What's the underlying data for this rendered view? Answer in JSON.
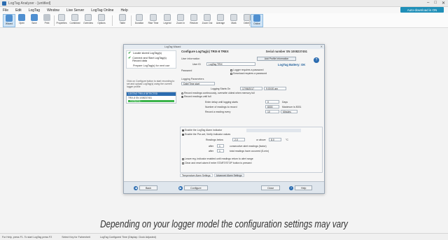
{
  "window": {
    "title": "LogTag Analyzer - [untitled]",
    "controls": [
      "–",
      "□",
      "✕"
    ]
  },
  "menu": [
    "File",
    "Edit",
    "LogTag",
    "Window",
    "Live Server",
    "LogTag Online",
    "Help"
  ],
  "auto_download": "Auto-download is ON",
  "toolbar": [
    {
      "label": "Wizard",
      "icon": "wizard-icon",
      "active": true
    },
    {
      "label": "Open",
      "icon": "open-icon"
    },
    {
      "label": "Save",
      "icon": "save-icon"
    },
    {
      "label": "Print",
      "icon": "print-icon"
    },
    {
      "label": "Properties",
      "icon": "properties-icon"
    },
    {
      "label": "Combined",
      "icon": "combined-icon"
    },
    {
      "label": "Overview",
      "icon": "overview-icon"
    },
    {
      "label": "Options",
      "icon": "options-icon"
    },
    {
      "label": "Table",
      "icon": "table-icon"
    },
    {
      "label": "Duration",
      "icon": "duration-icon"
    },
    {
      "label": "Rise Time",
      "icon": "rise-time-icon"
    },
    {
      "label": "Legend",
      "icon": "legend-icon"
    },
    {
      "label": "Zoom In",
      "icon": "zoom-in-icon"
    },
    {
      "label": "Restore",
      "icon": "restore-icon"
    },
    {
      "label": "Zoom Out",
      "icon": "zoom-out-icon"
    },
    {
      "label": "Average",
      "icon": "average-icon"
    },
    {
      "label": "Mark",
      "icon": "mark-icon"
    },
    {
      "label": "Delete",
      "icon": "delete-icon"
    },
    {
      "label": "Online",
      "icon": "online-icon"
    }
  ],
  "dialog": {
    "title": "LogTag Wizard",
    "steps": [
      {
        "label": "Locate stored LogTag(s)",
        "done": true
      },
      {
        "label": "Connect and Start LogTag(s) Record data",
        "done": true
      },
      {
        "label": "Prepare LogTag(s) for next use",
        "done": false
      }
    ],
    "help_text": "Click on Configure button to start recording to set and upload LogTag(s) using the current logger profile",
    "logger_box": {
      "header": "LOGTAG TRIX-8 DETECTED",
      "id": "TRIX-8 SN 1008237451",
      "status": "Configuring..."
    },
    "heading": "Configure LogTag(s) TRIX-8 TREX",
    "serial": "Serial number SN 1008237451",
    "user_info_label": "User information",
    "user_id_label": "User ID",
    "user_id_value": "LogTag TRIX",
    "battery": "LogTag Battery: OK",
    "password_label": "Password",
    "pw_reconfig": "Logger requires a password",
    "pw_download": "Download requires a password",
    "logging_params": "Logging Parameters",
    "start_mode": "Date/Time start",
    "begin_label": "Logging Starts On",
    "begin_date": "17/06/2017",
    "begin_time": "9:00:00 am",
    "record_continuous": "Record readings continuously, overwrite oldest when memory full",
    "record_full": "Record readings until full",
    "delay_label": "Enter delay until logging starts",
    "delay_value": "0",
    "delay_unit": "Days",
    "readings_label": "Number of readings to record",
    "readings_value": "8000",
    "readings_max": "Maximum is 8031",
    "interval_label": "Record a reading every",
    "interval_value": "10",
    "interval_unit": "Minutes",
    "advanced_btn": "Add Profile Information",
    "alarm": {
      "enable_alarm": "Enable the LogTag Alarm indicator",
      "enable_limits": "Enable the Pre-set, Verify Indicator values",
      "lower_label": "Readings below",
      "lower_value": "2.0",
      "upper_label": "or above",
      "upper_value": "8.0",
      "unit": "°C",
      "consec_label": "consecutive alert readings (factor)",
      "total_label": "total readings have occurred (5-min)",
      "after_label1": "after",
      "after_value1": "1",
      "after_label2": "after",
      "after_value2": "1",
      "reset_label": "Leave reg. indicator enabled until readings return to alert range",
      "clear_label": "Clear and reset alarm if enter START/STOP button is pressed"
    },
    "tabs": [
      "Temperature Alarm Settings",
      "Advanced Alarm Settings"
    ],
    "footer": {
      "back": "Back",
      "configure": "Configure",
      "cancel": "Close",
      "help": "Help"
    }
  },
  "caption": "Depending on your logger model the configuration settings may vary",
  "status": [
    "For Help, press F1. To start LogTag press F2",
    "Select Key for Fahrenheit",
    "LogTag Configured Time (Display: Clock Adjusted)"
  ]
}
